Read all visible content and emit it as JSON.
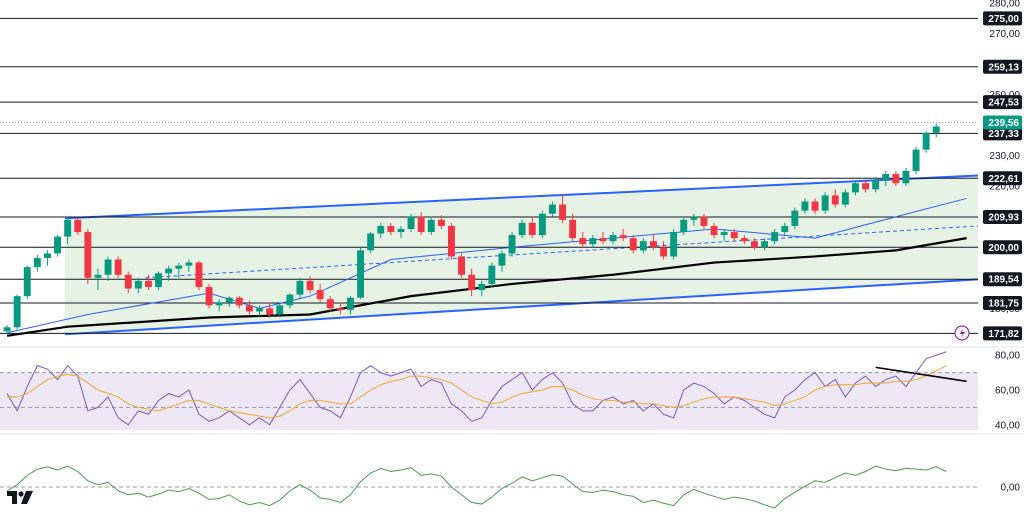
{
  "colors": {
    "up": "#089981",
    "down": "#f23645",
    "channel": "#2962ff",
    "channel_fill": "#e3f2e1",
    "ma_black": "#000000",
    "ma_blue": "#2962ff",
    "rsi": "#7e57c2",
    "rsi_signal": "#f5a623",
    "rsi_band": "#ede7f6",
    "momentum": "#43a047",
    "price_tag_bg": "#089981",
    "level_tag_bg": "#131722"
  },
  "icons": {
    "alert": "lightning-icon",
    "logo": "tradingview-logo-icon"
  },
  "chart_data": [
    {
      "type": "candlestick",
      "panel": "price",
      "ylim": [
        168,
        281
      ],
      "grid": false,
      "y_ticks": [
        "280,00",
        "270,00",
        "250,00",
        "230,00",
        "220,00",
        "180,00"
      ],
      "horizontal_levels": [
        "275,00",
        "259,13",
        "247,53",
        "237,33",
        "222,61",
        "209,93",
        "200,00",
        "189,54",
        "181,75",
        "171,82"
      ],
      "last_price_label": "239,56",
      "last_price": 239.56,
      "channel": {
        "upper": [
          [
            0,
            209.5
          ],
          [
            95,
            223.5
          ]
        ],
        "lower": [
          [
            0,
            171.5
          ],
          [
            95,
            189.5
          ]
        ],
        "mid_dashed": [
          [
            4,
            190
          ],
          [
            95,
            207
          ]
        ]
      },
      "moving_averages": [
        {
          "color": "blue",
          "points": [
            [
              0,
              172
            ],
            [
              8,
              178
            ],
            [
              20,
              185
            ],
            [
              25,
              180
            ],
            [
              30,
              184
            ],
            [
              38,
              196
            ],
            [
              50,
              200
            ],
            [
              60,
              203
            ],
            [
              70,
              206
            ],
            [
              80,
              203
            ],
            [
              88,
              210
            ],
            [
              95,
              216
            ]
          ]
        },
        {
          "color": "black",
          "points": [
            [
              0,
              171
            ],
            [
              6,
              174
            ],
            [
              20,
              177
            ],
            [
              30,
              178
            ],
            [
              40,
              184
            ],
            [
              50,
              188
            ],
            [
              60,
              191
            ],
            [
              70,
              195
            ],
            [
              80,
              197
            ],
            [
              88,
              199
            ],
            [
              95,
              203
            ]
          ]
        }
      ],
      "candles": [
        [
          172.5,
          174.5,
          171.5,
          173.8
        ],
        [
          173.8,
          184.5,
          173.0,
          184.0
        ],
        [
          184.0,
          194.0,
          183.0,
          193.5
        ],
        [
          193.5,
          197.5,
          192.0,
          196.5
        ],
        [
          196.5,
          199.0,
          194.0,
          198.0
        ],
        [
          198.0,
          204.0,
          197.0,
          203.5
        ],
        [
          203.5,
          210.0,
          201.0,
          209.0
        ],
        [
          209.0,
          209.5,
          204.0,
          205.0
        ],
        [
          205.0,
          206.0,
          188.0,
          190.0
        ],
        [
          190.0,
          193.0,
          186.0,
          191.0
        ],
        [
          191.0,
          197.0,
          189.0,
          196.0
        ],
        [
          196.0,
          197.0,
          190.0,
          191.0
        ],
        [
          191.0,
          192.0,
          185.0,
          186.5
        ],
        [
          186.5,
          190.0,
          185.0,
          189.0
        ],
        [
          189.0,
          191.0,
          186.0,
          187.0
        ],
        [
          187.0,
          192.0,
          186.0,
          191.5
        ],
        [
          191.5,
          194.0,
          189.0,
          193.0
        ],
        [
          193.0,
          195.0,
          190.0,
          194.0
        ],
        [
          194.0,
          196.0,
          192.0,
          195.0
        ],
        [
          195.0,
          195.5,
          186.0,
          187.0
        ],
        [
          187.0,
          188.0,
          180.0,
          181.0
        ],
        [
          181.0,
          183.0,
          179.0,
          182.0
        ],
        [
          182.0,
          184.0,
          180.5,
          183.5
        ],
        [
          183.5,
          184.0,
          180.0,
          181.0
        ],
        [
          181.0,
          182.5,
          178.0,
          179.0
        ],
        [
          179.0,
          181.0,
          177.5,
          180.0
        ],
        [
          180.0,
          182.0,
          177.0,
          178.0
        ],
        [
          178.0,
          182.0,
          177.0,
          181.0
        ],
        [
          181.0,
          185.0,
          180.0,
          184.5
        ],
        [
          184.5,
          190.0,
          183.0,
          189.0
        ],
        [
          189.0,
          190.5,
          185.0,
          186.0
        ],
        [
          186.0,
          188.0,
          182.0,
          183.0
        ],
        [
          183.0,
          184.0,
          179.0,
          180.0
        ],
        [
          180.0,
          182.0,
          178.0,
          179.5
        ],
        [
          179.5,
          184.0,
          178.0,
          183.5
        ],
        [
          183.5,
          200.0,
          183.0,
          199.0
        ],
        [
          199.0,
          205.0,
          198.0,
          204.5
        ],
        [
          204.5,
          208.0,
          203.0,
          207.0
        ],
        [
          207.0,
          208.0,
          204.0,
          205.0
        ],
        [
          205.0,
          207.0,
          203.0,
          206.0
        ],
        [
          206.0,
          211.0,
          205.0,
          210.0
        ],
        [
          210.0,
          211.5,
          204.0,
          205.0
        ],
        [
          205.0,
          210.0,
          204.0,
          209.0
        ],
        [
          209.0,
          210.5,
          206.0,
          207.0
        ],
        [
          207.0,
          208.0,
          196.0,
          197.0
        ],
        [
          197.0,
          198.0,
          190.0,
          191.0
        ],
        [
          191.0,
          193.0,
          184.0,
          186.0
        ],
        [
          186.0,
          189.0,
          184.0,
          188.0
        ],
        [
          188.0,
          195.0,
          187.0,
          194.0
        ],
        [
          194.0,
          199.0,
          192.0,
          198.0
        ],
        [
          198.0,
          205.0,
          197.0,
          204.0
        ],
        [
          204.0,
          209.0,
          203.0,
          208.0
        ],
        [
          208.0,
          210.0,
          203.0,
          204.0
        ],
        [
          204.0,
          212.0,
          203.0,
          211.0
        ],
        [
          211.0,
          215.0,
          210.0,
          214.0
        ],
        [
          214.0,
          217.5,
          208.0,
          209.0
        ],
        [
          209.0,
          211.0,
          202.0,
          203.0
        ],
        [
          203.0,
          205.0,
          200.0,
          201.0
        ],
        [
          201.0,
          204.0,
          200.0,
          203.0
        ],
        [
          203.0,
          205.0,
          201.0,
          202.0
        ],
        [
          202.0,
          205.0,
          201.0,
          204.0
        ],
        [
          204.0,
          206.0,
          202.0,
          203.0
        ],
        [
          203.0,
          204.0,
          198.0,
          199.0
        ],
        [
          199.0,
          203.0,
          198.0,
          202.0
        ],
        [
          202.0,
          204.0,
          199.0,
          200.0
        ],
        [
          200.0,
          202.0,
          196.0,
          197.0
        ],
        [
          197.0,
          206.0,
          196.0,
          205.0
        ],
        [
          205.0,
          210.0,
          204.0,
          209.0
        ],
        [
          209.0,
          211.0,
          207.0,
          210.0
        ],
        [
          210.0,
          211.0,
          206.0,
          207.0
        ],
        [
          207.0,
          208.0,
          203.0,
          204.0
        ],
        [
          204.0,
          206.0,
          202.0,
          205.0
        ],
        [
          205.0,
          206.0,
          202.0,
          203.0
        ],
        [
          203.0,
          204.0,
          201.0,
          202.0
        ],
        [
          202.0,
          203.0,
          199.0,
          200.0
        ],
        [
          200.0,
          203.0,
          199.0,
          202.0
        ],
        [
          202.0,
          206.0,
          201.0,
          205.0
        ],
        [
          205.0,
          208.0,
          204.0,
          207.0
        ],
        [
          207.0,
          213.0,
          206.0,
          212.0
        ],
        [
          212.0,
          216.0,
          211.0,
          215.0
        ],
        [
          215.0,
          216.0,
          211.0,
          212.0
        ],
        [
          212.0,
          218.0,
          211.0,
          217.0
        ],
        [
          217.0,
          219.0,
          213.0,
          214.0
        ],
        [
          214.0,
          219.0,
          213.0,
          218.0
        ],
        [
          218.0,
          222.0,
          217.0,
          221.0
        ],
        [
          221.0,
          222.0,
          218.0,
          219.0
        ],
        [
          219.0,
          223.0,
          218.0,
          222.0
        ],
        [
          222.0,
          225.0,
          220.0,
          224.0
        ],
        [
          224.0,
          225.0,
          220.0,
          221.0
        ],
        [
          221.0,
          226.0,
          220.0,
          225.0
        ],
        [
          225.0,
          233.0,
          224.0,
          232.0
        ],
        [
          232.0,
          238.0,
          231.0,
          237.5
        ],
        [
          237.5,
          240.5,
          236.0,
          239.56
        ]
      ]
    },
    {
      "type": "line",
      "panel": "rsi",
      "ylim": [
        37,
        83
      ],
      "y_ticks": [
        "80,00",
        "60,00",
        "40,00"
      ],
      "bands": [
        70,
        50
      ],
      "series": [
        {
          "color": "rsi",
          "values": [
            58,
            48,
            62,
            74,
            72,
            66,
            74,
            68,
            48,
            50,
            56,
            44,
            40,
            48,
            46,
            54,
            58,
            56,
            60,
            46,
            42,
            44,
            48,
            44,
            40,
            44,
            40,
            50,
            60,
            66,
            58,
            50,
            48,
            44,
            56,
            70,
            74,
            70,
            68,
            70,
            72,
            62,
            66,
            64,
            52,
            48,
            42,
            44,
            54,
            62,
            66,
            70,
            60,
            66,
            70,
            64,
            52,
            48,
            48,
            54,
            56,
            52,
            54,
            48,
            52,
            46,
            44,
            60,
            64,
            62,
            58,
            52,
            56,
            54,
            50,
            46,
            44,
            56,
            60,
            66,
            70,
            62,
            66,
            56,
            64,
            68,
            62,
            66,
            68,
            62,
            70,
            78,
            80,
            82
          ]
        },
        {
          "color": "rsi_signal",
          "values": [
            56,
            56,
            58,
            62,
            66,
            68,
            69,
            68,
            64,
            60,
            58,
            56,
            52,
            50,
            49,
            48,
            50,
            52,
            54,
            54,
            52,
            50,
            48,
            47,
            46,
            45,
            44,
            45,
            48,
            52,
            54,
            54,
            53,
            52,
            52,
            56,
            60,
            63,
            65,
            66,
            68,
            68,
            67,
            66,
            64,
            60,
            56,
            54,
            52,
            53,
            56,
            58,
            59,
            60,
            62,
            62,
            60,
            57,
            55,
            54,
            54,
            53,
            53,
            52,
            52,
            51,
            50,
            51,
            53,
            55,
            56,
            56,
            56,
            55,
            54,
            53,
            51,
            52,
            54,
            56,
            60,
            62,
            63,
            63,
            63,
            64,
            64,
            64,
            65,
            65,
            66,
            68,
            71,
            74
          ]
        }
      ],
      "trendline": [
        [
          86,
          73
        ],
        [
          95,
          65
        ]
      ]
    },
    {
      "type": "line",
      "panel": "momentum",
      "ylim": [
        -4,
        4
      ],
      "y_ticks": [
        "0,00"
      ],
      "zero_line": true,
      "series": [
        {
          "color": "momentum",
          "values": [
            -0.5,
            0.3,
            1.5,
            2.3,
            2.6,
            2.2,
            2.7,
            2.0,
            0.8,
            0.3,
            0.6,
            -0.5,
            -1.0,
            -0.8,
            -1.3,
            -0.9,
            -0.4,
            -0.6,
            -0.2,
            -0.8,
            -1.6,
            -1.5,
            -1.0,
            -1.8,
            -2.3,
            -2.0,
            -2.4,
            -1.7,
            -0.5,
            0.3,
            -0.4,
            -1.4,
            -1.6,
            -2.0,
            -1.0,
            0.7,
            1.8,
            2.4,
            2.0,
            2.2,
            2.5,
            1.5,
            1.7,
            1.4,
            0.0,
            -1.0,
            -2.0,
            -2.2,
            -1.3,
            -0.2,
            0.5,
            1.3,
            0.8,
            1.2,
            1.6,
            1.4,
            0.4,
            -0.6,
            -0.7,
            -0.4,
            -0.6,
            -1.0,
            -1.2,
            -2.0,
            -1.7,
            -2.1,
            -2.4,
            -1.0,
            -0.3,
            -0.8,
            -1.2,
            -1.6,
            -1.3,
            -1.5,
            -1.8,
            -2.3,
            -2.7,
            -1.5,
            -0.7,
            0.1,
            0.8,
            0.6,
            1.2,
            1.8,
            1.5,
            2.0,
            2.7,
            2.3,
            2.1,
            2.4,
            2.3,
            2.2,
            2.6,
            2.0
          ]
        }
      ]
    }
  ]
}
